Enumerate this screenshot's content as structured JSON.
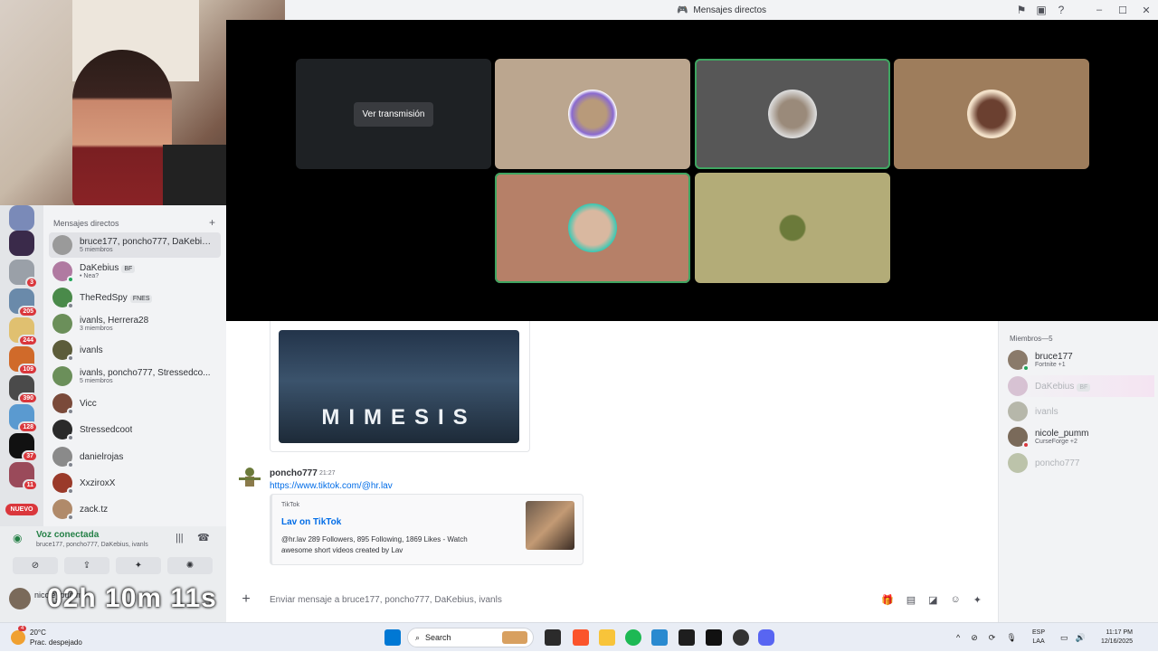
{
  "window": {
    "title": "Mensajes directos"
  },
  "call": {
    "stream_button": "Ver transmisión"
  },
  "servers": {
    "badges": [
      "3",
      "205",
      "244",
      "109",
      "390",
      "128",
      "37",
      "11"
    ],
    "new_label": "NUEVO"
  },
  "dm": {
    "header": "Mensajes directos",
    "items": [
      {
        "name": "bruce177, poncho777, DaKebius...",
        "sub": "5 miembros",
        "color": "#9a9a9a"
      },
      {
        "name": "DaKebius",
        "tag": "BF",
        "sub": "• Nea?",
        "color": "#b07aa1"
      },
      {
        "name": "TheRedSpy",
        "tag": "FNES",
        "sub": "",
        "color": "#4a8a4a"
      },
      {
        "name": "ivanls, Herrera28",
        "sub": "3 miembros",
        "color": "#6b8f5a"
      },
      {
        "name": "ivanls",
        "sub": "",
        "color": "#5c5c3a"
      },
      {
        "name": "ivanls, poncho777, Stressedco...",
        "sub": "5 miembros",
        "color": "#6b8f5a"
      },
      {
        "name": "Vicc",
        "sub": "",
        "color": "#7a4a3a"
      },
      {
        "name": "Stressedcoot",
        "sub": "",
        "color": "#2a2a2a"
      },
      {
        "name": "danielrojas",
        "sub": "",
        "color": "#8a8a8a"
      },
      {
        "name": "XxziroxX",
        "sub": "",
        "color": "#9a3a2a"
      },
      {
        "name": "zack.tz",
        "sub": "",
        "color": "#b08a6a"
      }
    ]
  },
  "voice": {
    "title": "Voz conectada",
    "members": "bruce177, poncho777, DaKebius, ivanls",
    "timer": "02h 10m 11s",
    "user": "nicole_pumm"
  },
  "chat": {
    "game_title": "MIMESIS",
    "author": "poncho777",
    "time": "21:27",
    "link": "https://www.tiktok.com/@hr.lav",
    "embed_provider": "TikTok",
    "embed_title": "Lav on TikTok",
    "embed_desc": "@hr.lav 289 Followers, 895 Following, 1869 Likes - Watch awesome short videos created by Lav",
    "placeholder": "Enviar mensaje a bruce177, poncho777, DaKebius, ivanls"
  },
  "members": {
    "header": "Miembros—5",
    "list": [
      {
        "name": "bruce177",
        "sub": "Fortnite +1",
        "faded": false
      },
      {
        "name": "DaKebius",
        "tag": "BF",
        "sub": "",
        "faded": true
      },
      {
        "name": "ivanls",
        "sub": "",
        "faded": true
      },
      {
        "name": "nicole_pumm",
        "sub": "CurseForge +2",
        "faded": false
      },
      {
        "name": "poncho777",
        "sub": "",
        "faded": true
      }
    ]
  },
  "taskbar": {
    "temp": "20°C",
    "weather": "Prac. despejado",
    "weather_badge": "4",
    "search": "Search",
    "lang1": "ESP",
    "lang2": "LAA",
    "time": "11:17 PM",
    "date": "12/16/2025"
  },
  "colors": {
    "speaking": "#3fa561",
    "online": "#23a55a",
    "link": "#006ce7",
    "badge": "#da373c"
  }
}
